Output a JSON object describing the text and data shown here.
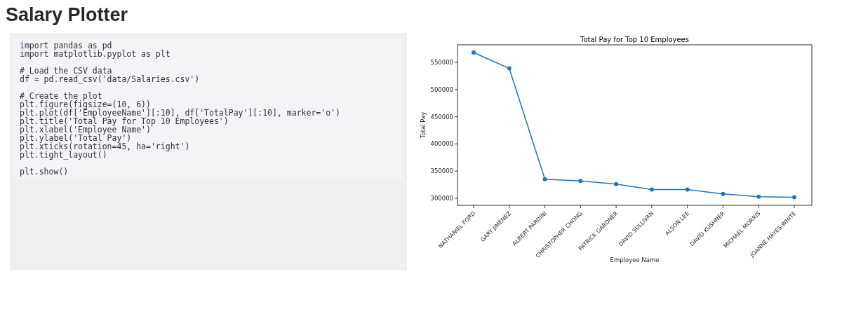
{
  "title": "Salary Plotter",
  "code": "import pandas as pd\nimport matplotlib.pyplot as plt\n\n# Load the CSV data\ndf = pd.read_csv('data/Salaries.csv')\n\n# Create the plot\nplt.figure(figsize=(10, 6))\nplt.plot(df['EmployeeName'][:10], df['TotalPay'][:10], marker='o')\nplt.title('Total Pay for Top 10 Employees')\nplt.xlabel('Employee Name')\nplt.ylabel('Total Pay')\nplt.xticks(rotation=45, ha='right')\nplt.tight_layout()\n\nplt.show()",
  "chart": {
    "chart_data": {
      "type": "line",
      "title": "Total Pay for Top 10 Employees",
      "xlabel": "Employee Name",
      "ylabel": "Total Pay",
      "categories": [
        "NATHANIEL FORD",
        "GARY JIMENEZ",
        "ALBERT PARDINI",
        "CHRISTOPHER CHONG",
        "PATRICK GARDNER",
        "DAVID SULLIVAN",
        "ALSON LEE",
        "DAVID KUSHNER",
        "MICHAEL MORRIS",
        "JOANNE HAYES-WHITE"
      ],
      "series": [
        {
          "color": "#1f77b4",
          "marker": "o",
          "values": [
            568000,
            539000,
            335000,
            332000,
            326000,
            316000,
            316000,
            308000,
            303000,
            302000
          ]
        }
      ],
      "ylim": [
        287100,
        582200
      ],
      "yticks": [
        300000,
        350000,
        400000,
        450000,
        500000,
        550000
      ]
    }
  }
}
